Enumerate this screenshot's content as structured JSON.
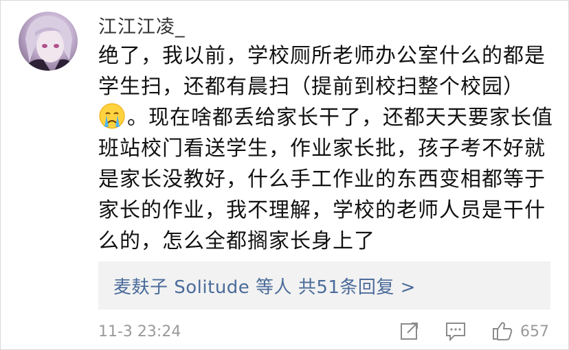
{
  "comment": {
    "username": "江江江凌_",
    "avatar_icon": "anime-avatar-icon",
    "lines": [
      "绝了，我以前，学校厕所老师办公室什么的都是",
      "学生扫，还都有晨扫（提前到校扫整个校园）",
      "。现在啥都丢给家长干了，还都天天要家长值",
      "班站校门看送学生，作业家长批，孩子考不好就",
      "是家长没教好，什么手工作业的东西变相都等于",
      "家长的作业，我不理解，学校的老师人员是干什",
      "么的，怎么全都搁家长身上了"
    ],
    "emoji_icon": "crying-face-emoji",
    "replies_label": "麦麸子 Solitude 等人  共51条回复 >",
    "date": "11-3 23:24",
    "like_count": "657",
    "actions": {
      "share_icon": "share-icon",
      "reply_icon": "comment-icon",
      "like_icon": "thumbs-up-icon"
    }
  },
  "colors": {
    "link": "#4a6b9a",
    "meta": "#9a9a9a",
    "replies_bg": "#f2f2f2"
  }
}
